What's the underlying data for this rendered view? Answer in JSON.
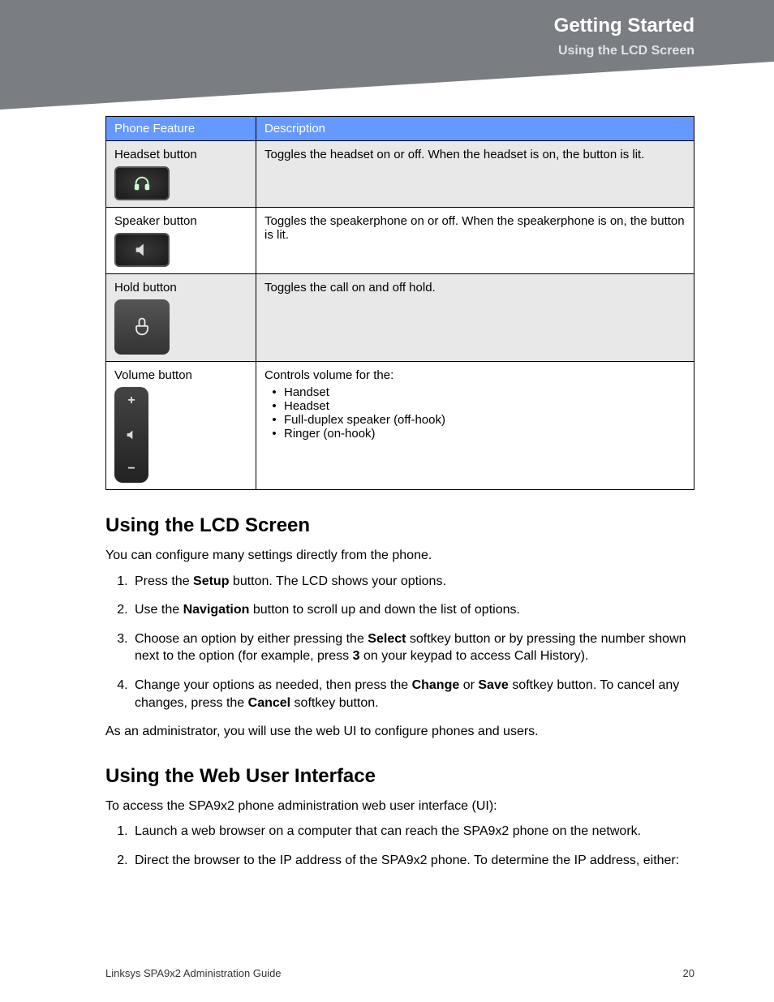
{
  "header": {
    "chapter": "Getting Started",
    "section": "Using the LCD Screen"
  },
  "table": {
    "col1": "Phone Feature",
    "col2": "Description",
    "rows": [
      {
        "feature": "Headset button",
        "desc": "Toggles the headset on or off. When the headset is on, the button is lit."
      },
      {
        "feature": "Speaker button",
        "desc": "Toggles the speakerphone on or off. When the speakerphone is on, the button is lit."
      },
      {
        "feature": "Hold button",
        "desc": "Toggles the call on and off hold."
      },
      {
        "feature": "Volume button",
        "desc_lead": "Controls volume for the:",
        "bullets": [
          "Handset",
          "Headset",
          "Full-duplex speaker (off-hook)",
          "Ringer (on-hook)"
        ]
      }
    ]
  },
  "section1": {
    "heading": "Using the LCD Screen",
    "intro": "You can configure many settings directly from the phone.",
    "steps": {
      "s1a": "Press the ",
      "s1b": "Setup",
      "s1c": " button. The LCD shows your options.",
      "s2a": "Use the ",
      "s2b": "Navigation",
      "s2c": " button to scroll up and down the list of options.",
      "s3a": "Choose an option by either pressing the ",
      "s3b": "Select",
      "s3c": " softkey button or by pressing the number shown next to the option (for example, press ",
      "s3d": "3",
      "s3e": " on your keypad to access Call History).",
      "s4a": "Change your options as needed, then press the ",
      "s4b": "Change",
      "s4c": " or ",
      "s4d": "Save",
      "s4e": " softkey button. To cancel any changes, press the ",
      "s4f": "Cancel",
      "s4g": " softkey button."
    },
    "outro": "As an administrator, you will use the web UI to configure phones and users."
  },
  "section2": {
    "heading": "Using the Web User Interface",
    "intro": "To access the SPA9x2 phone administration web user interface (UI):",
    "steps": [
      "Launch a web browser on a computer that can reach the SPA9x2 phone on the network.",
      "Direct the browser to the IP address of the SPA9x2 phone. To determine the IP address, either:"
    ]
  },
  "footer": {
    "title": "Linksys SPA9x2 Administration Guide",
    "page": "20"
  }
}
